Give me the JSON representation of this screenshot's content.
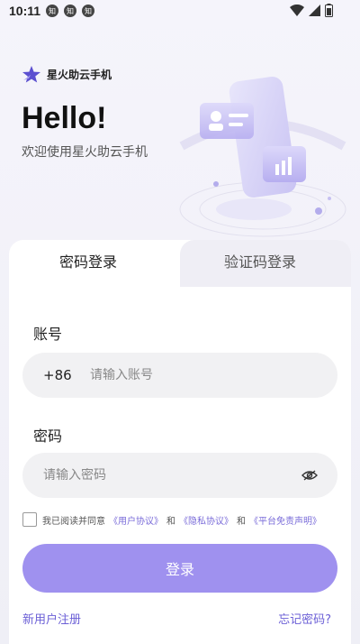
{
  "status_bar": {
    "time": "10:11",
    "notif_icons": [
      "知",
      "知",
      "知"
    ]
  },
  "brand": {
    "name": "星火助云手机",
    "logo_icon": "star-logo-icon",
    "accent": "#6b5fd6"
  },
  "hero": {
    "title": "Hello!",
    "subtitle": "欢迎使用星火助云手机"
  },
  "tabs": [
    {
      "label": "密码登录",
      "active": true
    },
    {
      "label": "验证码登录",
      "active": false
    }
  ],
  "account": {
    "label": "账号",
    "prefix": "+86",
    "placeholder": "请输入账号",
    "value": ""
  },
  "password": {
    "label": "密码",
    "placeholder": "请输入密码",
    "value": ""
  },
  "agreement": {
    "text": "我已阅读并同意",
    "user_agreement": "《用户协议》",
    "and1": "和",
    "privacy": "《隐私协议》",
    "and2": "和",
    "disclaimer": "《平台免责声明》",
    "checked": false
  },
  "login_button": {
    "label": "登录",
    "color": "#9f91ef"
  },
  "footer": {
    "register": "新用户注册",
    "forgot": "忘记密码?"
  }
}
